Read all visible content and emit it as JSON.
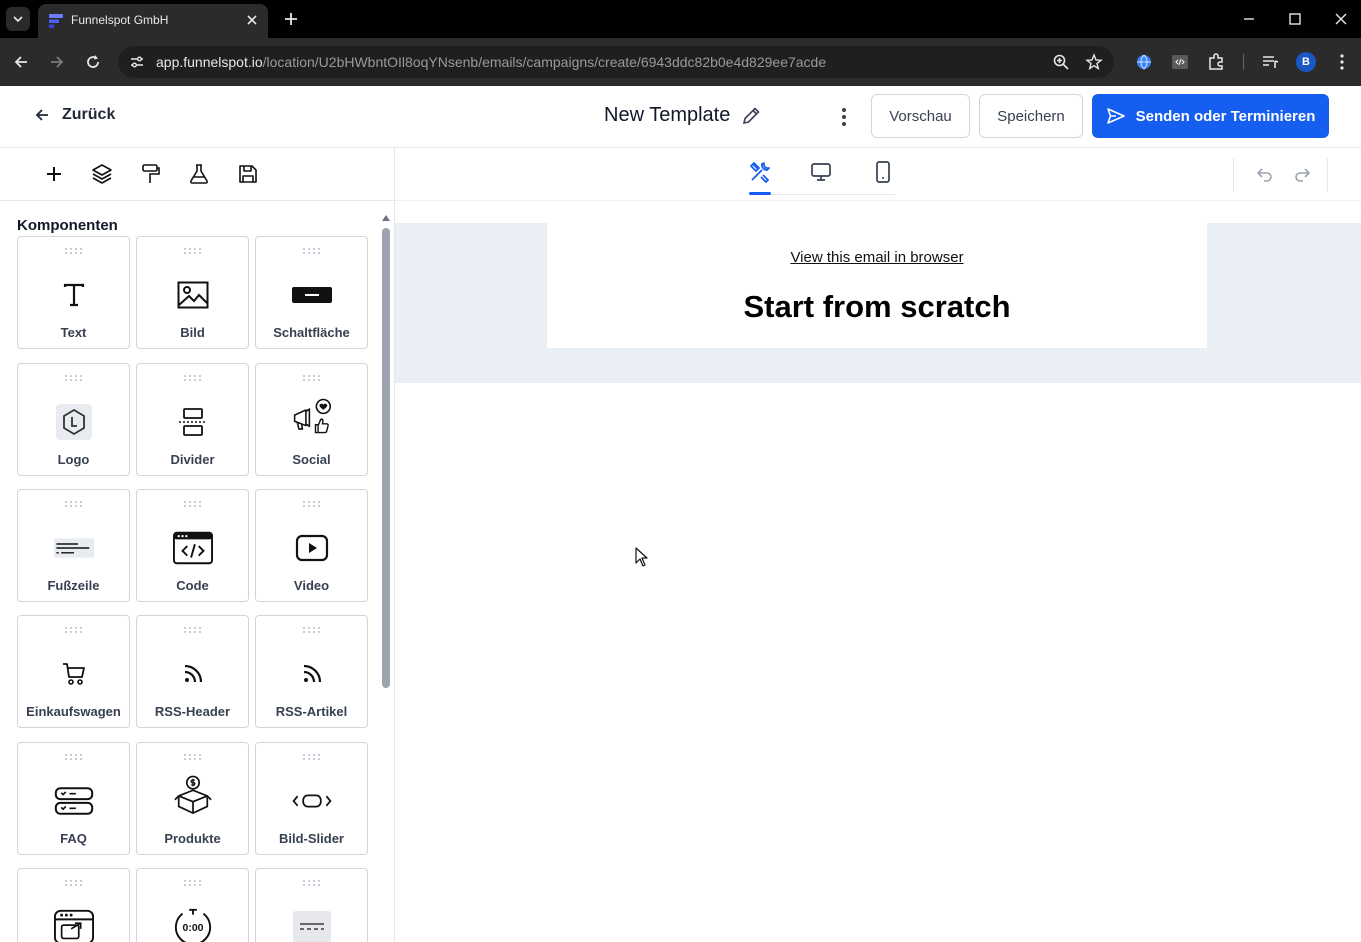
{
  "browser": {
    "tab_title": "Funnelspot GmbH",
    "url_host": "app.funnelspot.io",
    "url_path": "/location/U2bHWbntOIl8oqYNsenb/emails/campaigns/create/6943ddc82b0e4d829ee7acde",
    "profile_initial": "B"
  },
  "header": {
    "back_label": "Zurück",
    "template_title": "New Template",
    "preview_label": "Vorschau",
    "save_label": "Speichern",
    "send_label": "Senden oder Terminieren"
  },
  "sidebar": {
    "heading": "Komponenten",
    "components": [
      {
        "label": "Text",
        "icon": "text-icon"
      },
      {
        "label": "Bild",
        "icon": "image-icon"
      },
      {
        "label": "Schaltfläche",
        "icon": "button-icon"
      },
      {
        "label": "Logo",
        "icon": "logo-icon"
      },
      {
        "label": "Divider",
        "icon": "divider-icon"
      },
      {
        "label": "Social",
        "icon": "social-icon"
      },
      {
        "label": "Fußzeile",
        "icon": "footer-icon"
      },
      {
        "label": "Code",
        "icon": "code-icon"
      },
      {
        "label": "Video",
        "icon": "video-icon"
      },
      {
        "label": "Einkaufswagen",
        "icon": "cart-icon"
      },
      {
        "label": "RSS-Header",
        "icon": "rss-icon"
      },
      {
        "label": "RSS-Artikel",
        "icon": "rss-icon"
      },
      {
        "label": "FAQ",
        "icon": "faq-icon"
      },
      {
        "label": "Produkte",
        "icon": "products-icon"
      },
      {
        "label": "Bild-Slider",
        "icon": "slider-icon"
      },
      {
        "label": "",
        "icon": "browser-link-icon"
      },
      {
        "label": "",
        "icon": "countdown-icon"
      },
      {
        "label": "",
        "icon": "separator-icon"
      }
    ]
  },
  "countdown_text": "0:00",
  "email": {
    "view_link": "View this email in browser",
    "title": "Start from scratch"
  },
  "colors": {
    "primary": "#155eef",
    "canvas_bg": "#eaeef5"
  }
}
